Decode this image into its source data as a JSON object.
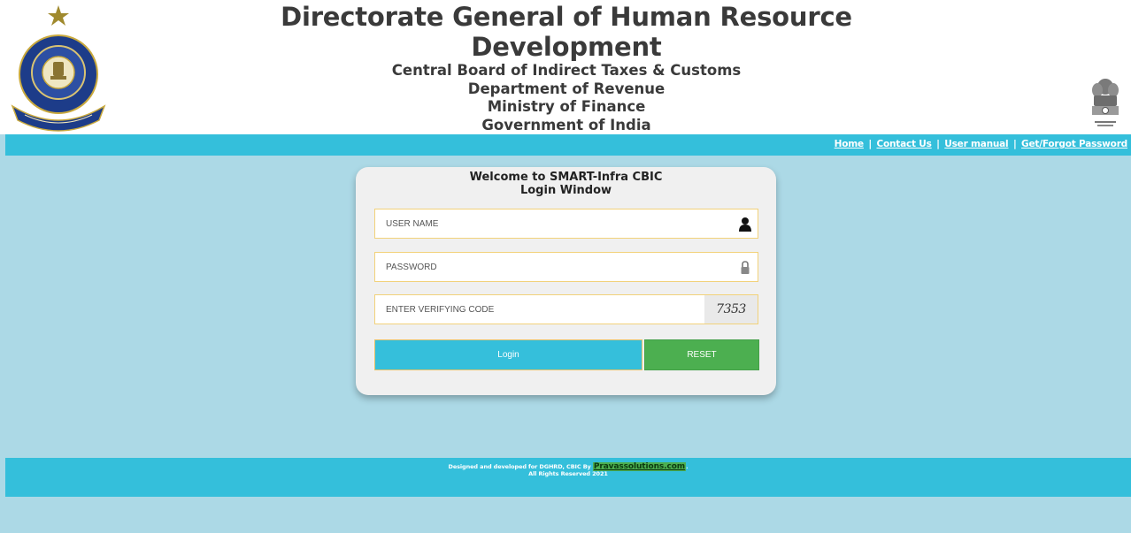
{
  "header": {
    "title": "Directorate General of Human Resource Development",
    "lines": [
      "Central Board of Indirect Taxes & Customs",
      "Department of Revenue",
      "Ministry of Finance",
      "Government of India"
    ],
    "left_logo": {
      "icon": "cbic-emblem-icon",
      "text_top": "भारत का राजस्व ... ",
      "text_band": "समर्पण"
    },
    "right_logo": {
      "icon": "national-emblem-icon",
      "motto": "सत्यमेव जयते"
    }
  },
  "nav": {
    "links": [
      "Home",
      "Contact Us",
      "User manual",
      "Get/Forgot Password"
    ],
    "separator": "|"
  },
  "login": {
    "title_line1": "Welcome to SMART-Infra CBIC",
    "title_line2": "Login Window",
    "username_placeholder": "USER NAME",
    "password_placeholder": "PASSWORD",
    "code_placeholder": "ENTER VERIFYING CODE",
    "captcha_code": "7353",
    "login_label": "Login",
    "reset_label": "RESET",
    "icons": {
      "user": "user-icon",
      "password": "lock-icon"
    }
  },
  "footer": {
    "text_before": "Designed and developed for DGHRD, CBIC By",
    "link_text": "Pravassolutions.com",
    "text_after": ".",
    "rights": "All Rights Reserved 2021"
  },
  "colors": {
    "background": "#acd9e6",
    "bar": "#34bfdb",
    "login_button": "#35bfdb",
    "reset_button": "#4caf50",
    "field_border": "#f2d27a"
  }
}
